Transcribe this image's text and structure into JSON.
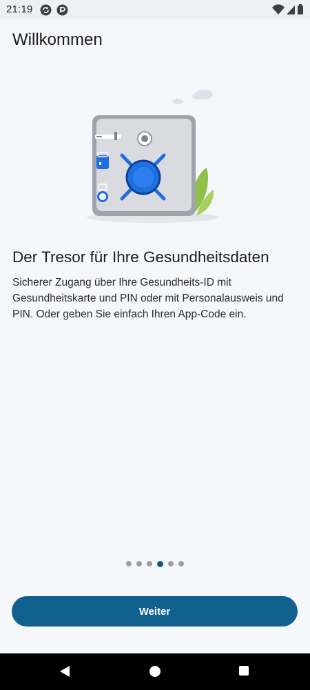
{
  "status_bar": {
    "time": "21:19",
    "app_icons": [
      "sync-app-icon",
      "pocket-app-icon"
    ],
    "system_icons": [
      "wifi-icon",
      "signal-icon",
      "battery-icon"
    ]
  },
  "header": {
    "title": "Willkommen"
  },
  "onboarding": {
    "illustration": "vault-safe-illustration",
    "headline": "Der Tresor für Ihre Gesundheitsdaten",
    "description": "Sicherer Zugang über Ihre Gesundheits-ID mit Gesundheitskarte und PIN oder mit Personalausweis und PIN. Oder geben Sie einfach Ihren App-Code ein."
  },
  "pager": {
    "total": 6,
    "current": 4
  },
  "footer": {
    "continue_label": "Weiter"
  },
  "colors": {
    "primary": "#11618f",
    "active_dot": "#0f5a85",
    "inactive_dot": "#9aa0a8",
    "accent_blue": "#1e6fe0",
    "leaf_green": "#8fc04a",
    "background": "#f6f7fb"
  },
  "nav_bar": {
    "buttons": [
      "back-icon",
      "home-icon",
      "recents-icon"
    ]
  }
}
